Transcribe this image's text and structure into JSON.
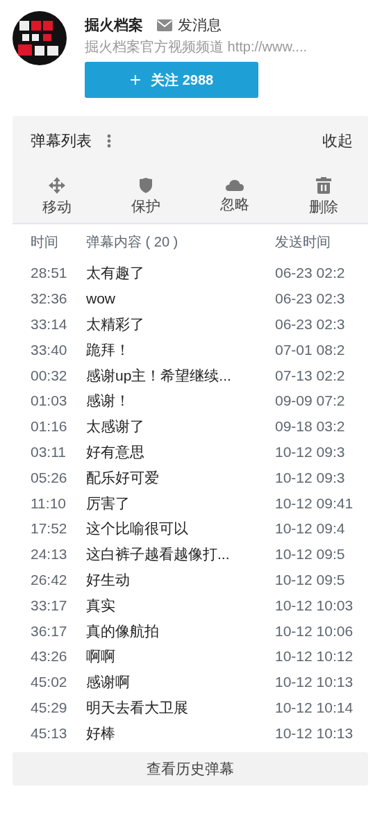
{
  "channel": {
    "name": "掘火档案",
    "message_link": "发消息",
    "description": "掘火档案官方视频频道 http://www....",
    "follow_button": "关注 2988",
    "follow_icon": "+"
  },
  "panel": {
    "title": "弹幕列表",
    "collapse": "收起",
    "actions": [
      {
        "kind": "move",
        "label": "移动"
      },
      {
        "kind": "protect",
        "label": "保护"
      },
      {
        "kind": "ignore",
        "label": "忽略"
      },
      {
        "kind": "delete",
        "label": "删除"
      }
    ],
    "columns": [
      "时间",
      "弹幕内容 ( 20 )",
      "发送时间"
    ],
    "rows": [
      {
        "time": "28:51",
        "content": "太有趣了",
        "sent": "06-23 02:2"
      },
      {
        "time": "32:36",
        "content": "wow",
        "sent": "06-23 02:3"
      },
      {
        "time": "33:14",
        "content": "太精彩了",
        "sent": "06-23 02:3"
      },
      {
        "time": "33:40",
        "content": "跪拜！",
        "sent": "07-01 08:2"
      },
      {
        "time": "00:32",
        "content": "感谢up主！希望继续...",
        "sent": "07-13 02:2"
      },
      {
        "time": "01:03",
        "content": "感谢！",
        "sent": "09-09 07:2"
      },
      {
        "time": "01:16",
        "content": "太感谢了",
        "sent": "09-18 03:2"
      },
      {
        "time": "03:11",
        "content": "好有意思",
        "sent": "10-12 09:3"
      },
      {
        "time": "05:26",
        "content": "配乐好可爱",
        "sent": "10-12 09:3"
      },
      {
        "time": "11:10",
        "content": "厉害了",
        "sent": "10-12 09:41"
      },
      {
        "time": "17:52",
        "content": "这个比喻很可以",
        "sent": "10-12 09:4"
      },
      {
        "time": "24:13",
        "content": "这白裤子越看越像打...",
        "sent": "10-12 09:5"
      },
      {
        "time": "26:42",
        "content": "好生动",
        "sent": "10-12 09:5"
      },
      {
        "time": "33:17",
        "content": "真实",
        "sent": "10-12 10:03"
      },
      {
        "time": "36:17",
        "content": "真的像航拍",
        "sent": "10-12 10:06"
      },
      {
        "time": "43:26",
        "content": "啊啊",
        "sent": "10-12 10:12"
      },
      {
        "time": "45:02",
        "content": "感谢啊",
        "sent": "10-12 10:13"
      },
      {
        "time": "45:29",
        "content": "明天去看大卫展",
        "sent": "10-12 10:14"
      },
      {
        "time": "45:13",
        "content": "好棒",
        "sent": "10-12 10:13"
      }
    ],
    "history_button": "查看历史弹幕"
  }
}
